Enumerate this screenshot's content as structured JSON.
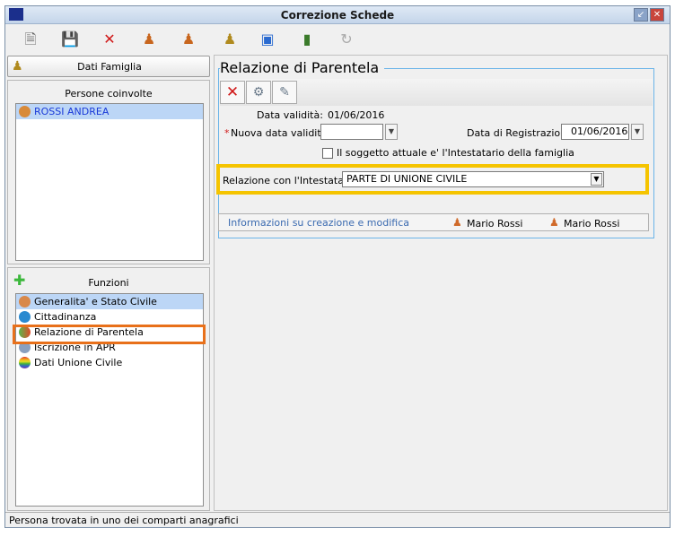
{
  "window": {
    "title": "Correzione Schede"
  },
  "toolbar": {
    "icons": [
      "new-document-icon",
      "save-icon",
      "delete-icon",
      "add-person-icon",
      "remove-person-icon",
      "family-icon",
      "window-info-icon",
      "archive-icon",
      "refresh-icon"
    ]
  },
  "left": {
    "family_button": "Dati Famiglia",
    "people_header": "Persone coinvolte",
    "people": [
      "ROSSI ANDREA"
    ],
    "functions_header": "Funzioni",
    "functions": [
      "Generalita' e Stato Civile",
      "Cittadinanza",
      "Relazione di Parentela",
      "Iscrizione in APR",
      "Dati Unione Civile"
    ]
  },
  "form": {
    "title": "Relazione di Parentela",
    "validity_label": "Data validità:",
    "validity_value": "01/06/2016",
    "required_mark": "*",
    "new_validity_label": "Nuova data validità",
    "new_validity_value": "",
    "registration_label": "Data di Registrazione",
    "registration_value": "01/06/2016",
    "head_checkbox_label": "Il soggetto attuale e' l'Intestatario della famiglia",
    "head_checked": false,
    "relation_label": "Relazione con l'Intestatario",
    "relation_value": "PARTE DI UNIONE CIVILE",
    "info_label": "Informazioni su creazione e modifica",
    "created_by": "Mario Rossi",
    "modified_by": "Mario Rossi"
  },
  "status": {
    "text": "Persona trovata in uno dei comparti anagrafici"
  },
  "colors": {
    "highlight_yellow": "#f5c400",
    "highlight_orange": "#e8701a",
    "selection": "#bcd6f6",
    "link": "#3a6ab0"
  }
}
